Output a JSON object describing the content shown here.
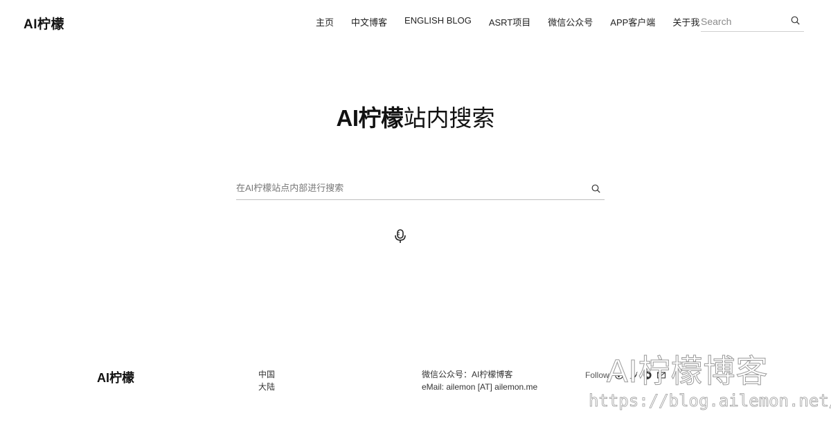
{
  "header": {
    "logo": "AI柠檬",
    "nav": [
      "主页",
      "中文博客",
      "ENGLISH BLOG",
      "ASRT项目",
      "微信公众号",
      "APP客户端",
      "关于我"
    ],
    "search_placeholder": "Search"
  },
  "hero": {
    "title_brand": "AI柠檬",
    "title_rest": "站内搜索",
    "search_placeholder": "在AI柠檬站点内部进行搜索"
  },
  "footer": {
    "logo": "AI柠檬",
    "location_line1": "中国",
    "location_line2": "大陆",
    "wechat": "微信公众号：AI柠檬博客",
    "email": "eMail: ailemon [AT] ailemon.me",
    "follow_label": "Follow",
    "social_icons": [
      "weibo-icon",
      "twitter-icon",
      "github-icon",
      "mail-icon"
    ]
  },
  "watermark": {
    "title": "AI柠檬博客",
    "url": "https://blog.ailemon.net/"
  }
}
